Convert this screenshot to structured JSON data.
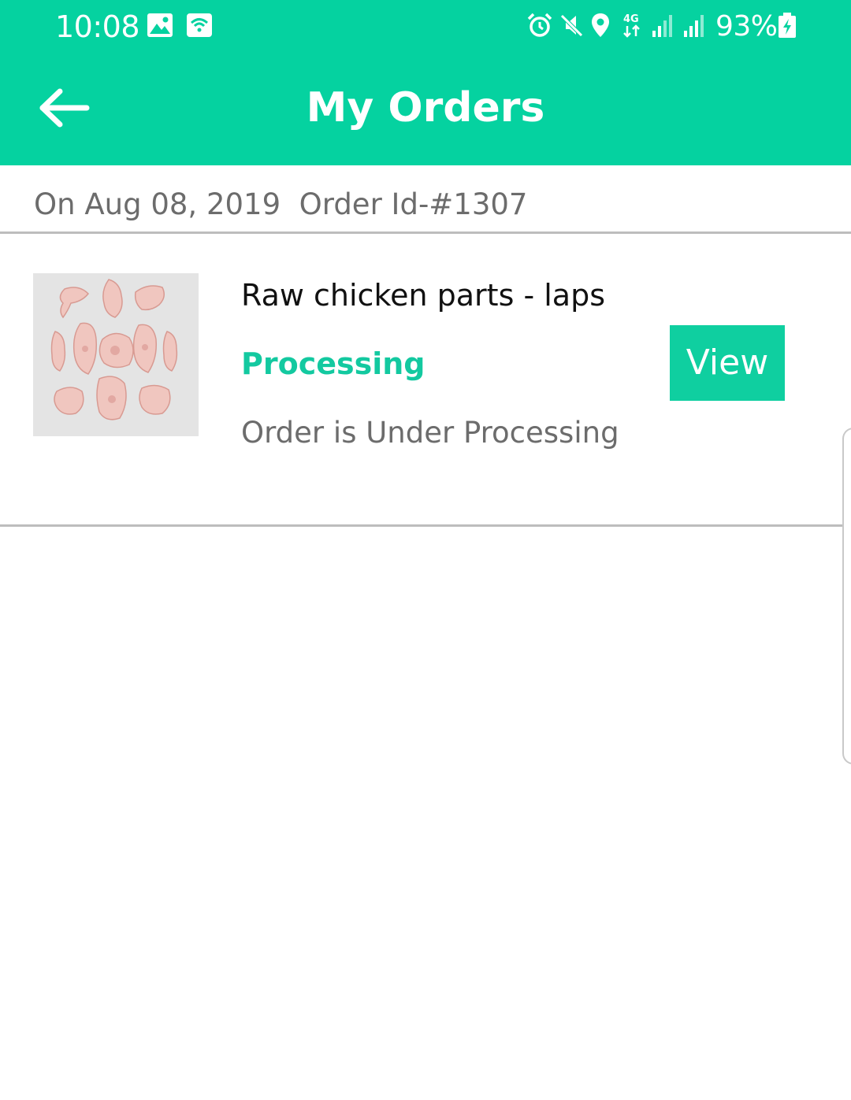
{
  "status_bar": {
    "time": "10:08",
    "battery_percent": "93%",
    "network_label": "4G",
    "icons": [
      "gallery-icon",
      "wifi-calling-icon",
      "alarm-icon",
      "mute-icon",
      "location-icon",
      "data-arrows-icon",
      "signal-icon",
      "signal-icon",
      "battery-charging-icon"
    ]
  },
  "header": {
    "back_icon": "arrow-left-icon",
    "title": "My Orders"
  },
  "order_group": {
    "header_text": "On Aug 08, 2019  Order Id-#1307"
  },
  "orders": [
    {
      "product_name": "Raw chicken parts - laps",
      "status": "Processing",
      "status_description": "Order is Under Processing",
      "view_label": "View"
    }
  ],
  "colors": {
    "primary": "#05d2a0",
    "status_text": "#13c9a0",
    "secondary_text": "#6c6c6c",
    "divider": "#bdbdbd"
  }
}
